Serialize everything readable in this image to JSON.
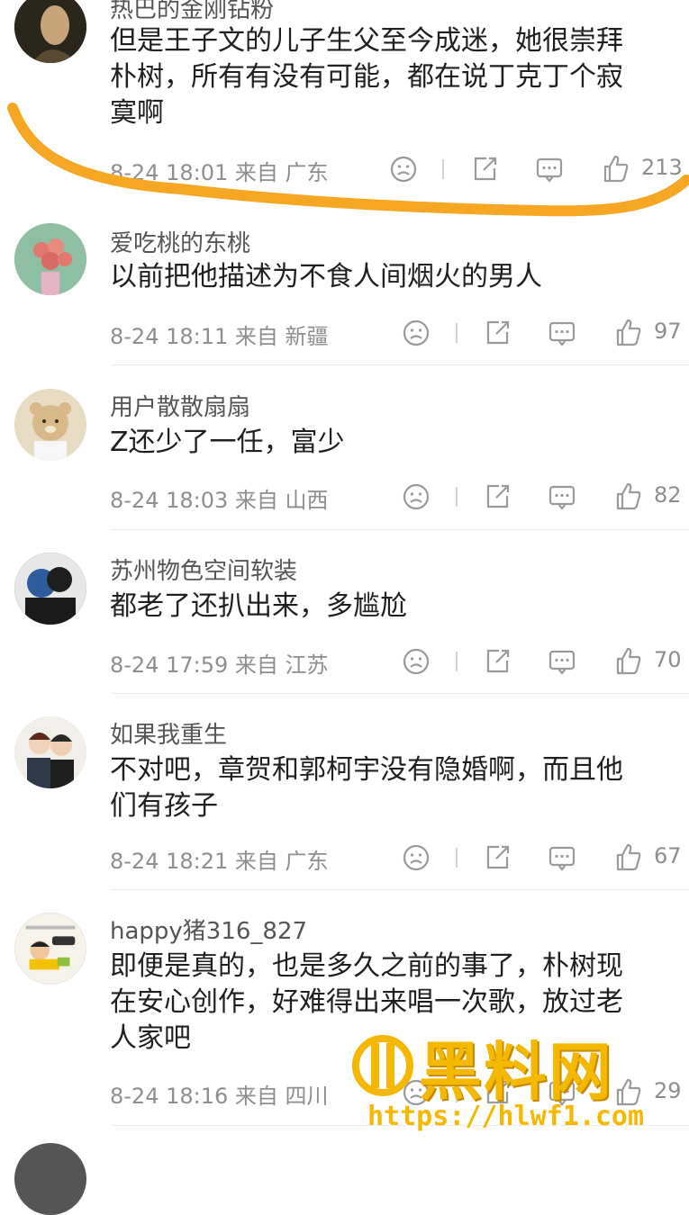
{
  "comments": [
    {
      "username": "热巴的金刚钻粉",
      "text": "但是王子文的儿子生父至今成迷，她很崇拜\n朴树，所有有没有可能，都在说丁克丁个寂\n寞啊",
      "time": "8-24 18:01 来自 广东",
      "likes": "213",
      "avatar_color": "#3a3326"
    },
    {
      "username": "爱吃桃的东桃",
      "text": "以前把他描述为不食人间烟火的男人",
      "time": "8-24 18:11 来自 新疆",
      "likes": "97",
      "avatar_color": "#7fae93"
    },
    {
      "username": "用户散散扇扇",
      "text": "Z还少了一任，富少",
      "time": "8-24 18:03 来自 山西",
      "likes": "82",
      "avatar_color": "#e6d3ae"
    },
    {
      "username": "苏州物色空间软装",
      "text": "都老了还扒出来，多尴尬",
      "time": "8-24 17:59 来自 江苏",
      "likes": "70",
      "avatar_color": "#2f3540"
    },
    {
      "username": "如果我重生",
      "text": "不对吧，章贺和郭柯宇没有隐婚啊，而且他\n们有孩子",
      "time": "8-24 18:21 来自 广东",
      "likes": "67",
      "avatar_color": "#d9d4cf"
    },
    {
      "username": "happy猪316_827",
      "text": "即便是真的，也是多久之前的事了，朴树现\n在安心创作，好难得出来唱一次歌，放过老\n人家吧",
      "time": "8-24 18:16 来自 四川",
      "likes": "29",
      "avatar_color": "#f4f1e8"
    }
  ],
  "watermark": {
    "brand": "黑料网",
    "url": "https://hlwf1.com"
  },
  "colors": {
    "highlight_stroke": "#f5a623",
    "icon_gray": "#9a9a9a",
    "watermark": "#f5b800"
  },
  "icons": [
    "dislike-face-icon",
    "share-icon",
    "reply-comment-icon",
    "thumbs-up-icon"
  ]
}
